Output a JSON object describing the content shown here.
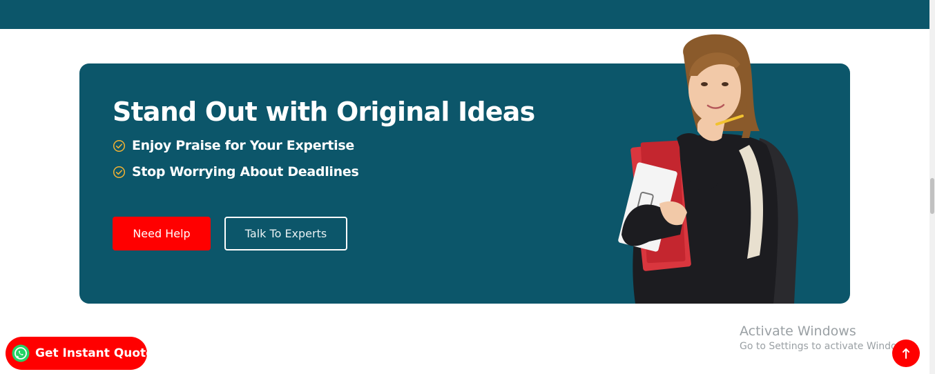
{
  "cta": {
    "headline": "Stand Out with Original Ideas",
    "bullets": [
      {
        "icon": "check-circle-icon",
        "text": "Enjoy Praise for Your Expertise"
      },
      {
        "icon": "check-circle-icon",
        "text": "Stop Worrying About Deadlines"
      }
    ],
    "primary_button": "Need Help",
    "secondary_button": "Talk To Experts",
    "image_alt": "student-with-notebooks-illustration"
  },
  "floating": {
    "quote_button": "Get Instant Quote",
    "quote_icon": "whatsapp-icon",
    "scroll_top_icon": "arrow-up-icon"
  },
  "watermark": {
    "title": "Activate Windows",
    "subtitle": "Go to Settings to activate Windows."
  },
  "colors": {
    "brand_teal": "#0c566a",
    "accent_red": "#ff0000",
    "check_yellow": "#f2b233",
    "whatsapp_green": "#25d366"
  }
}
